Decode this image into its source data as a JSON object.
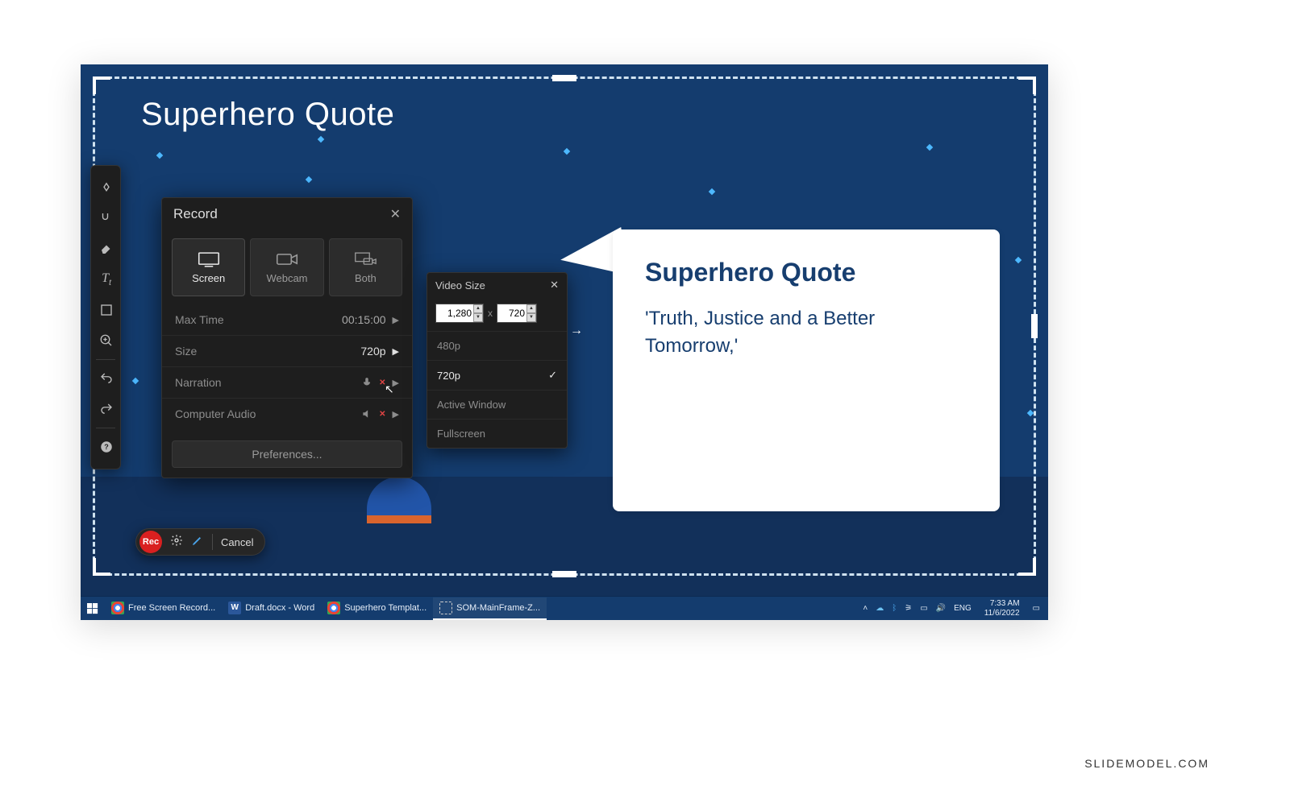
{
  "slide": {
    "title": "Superhero Quote",
    "card_title": "Superhero Quote",
    "card_body": "'Truth, Justice and a Better Tomorrow,'"
  },
  "record_panel": {
    "title": "Record",
    "sources": {
      "screen": "Screen",
      "webcam": "Webcam",
      "both": "Both"
    },
    "rows": {
      "maxtime_label": "Max Time",
      "maxtime_value": "00:15:00",
      "size_label": "Size",
      "size_value": "720p",
      "narration_label": "Narration",
      "audio_label": "Computer Audio"
    },
    "prefs": "Preferences..."
  },
  "video_size": {
    "title": "Video Size",
    "width": "1,280",
    "height": "720",
    "opts": {
      "o1": "480p",
      "o2": "720p",
      "o3": "Active Window",
      "o4": "Fullscreen"
    }
  },
  "rec_bar": {
    "rec": "Rec",
    "cancel": "Cancel"
  },
  "taskbar": {
    "items": [
      {
        "label": "Free Screen Record..."
      },
      {
        "label": "Draft.docx - Word"
      },
      {
        "label": "Superhero Templat..."
      },
      {
        "label": "SOM-MainFrame-Z..."
      }
    ],
    "lang": "ENG",
    "time": "7:33 AM",
    "date": "11/6/2022"
  },
  "watermark": "SLIDEMODEL.COM"
}
